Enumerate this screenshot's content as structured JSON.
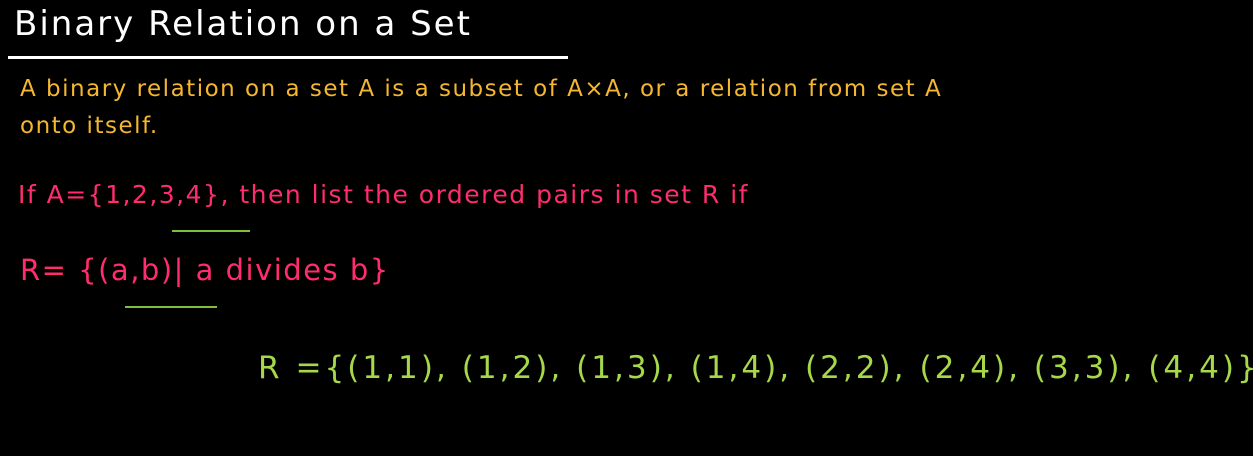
{
  "colors": {
    "background": "#000000",
    "title": "#ffffff",
    "definition": "#f5b731",
    "question": "#ff2d6e",
    "answer": "#a6d84a",
    "underline": "#7fbf3a"
  },
  "title": "Binary Relation on a Set",
  "definition": {
    "line1": "A binary relation on a set A is a subset of A×A, or a relation from set A",
    "line2": "onto itself."
  },
  "question": {
    "line1": "If A={1,2,3,4}, then list the ordered pairs in set R if",
    "line2": "R= {(a,b)| a divides b}"
  },
  "answer": "R ={(1,1), (1,2), (1,3), (1,4), (2,2), (2,4), (3,3), (4,4)}"
}
